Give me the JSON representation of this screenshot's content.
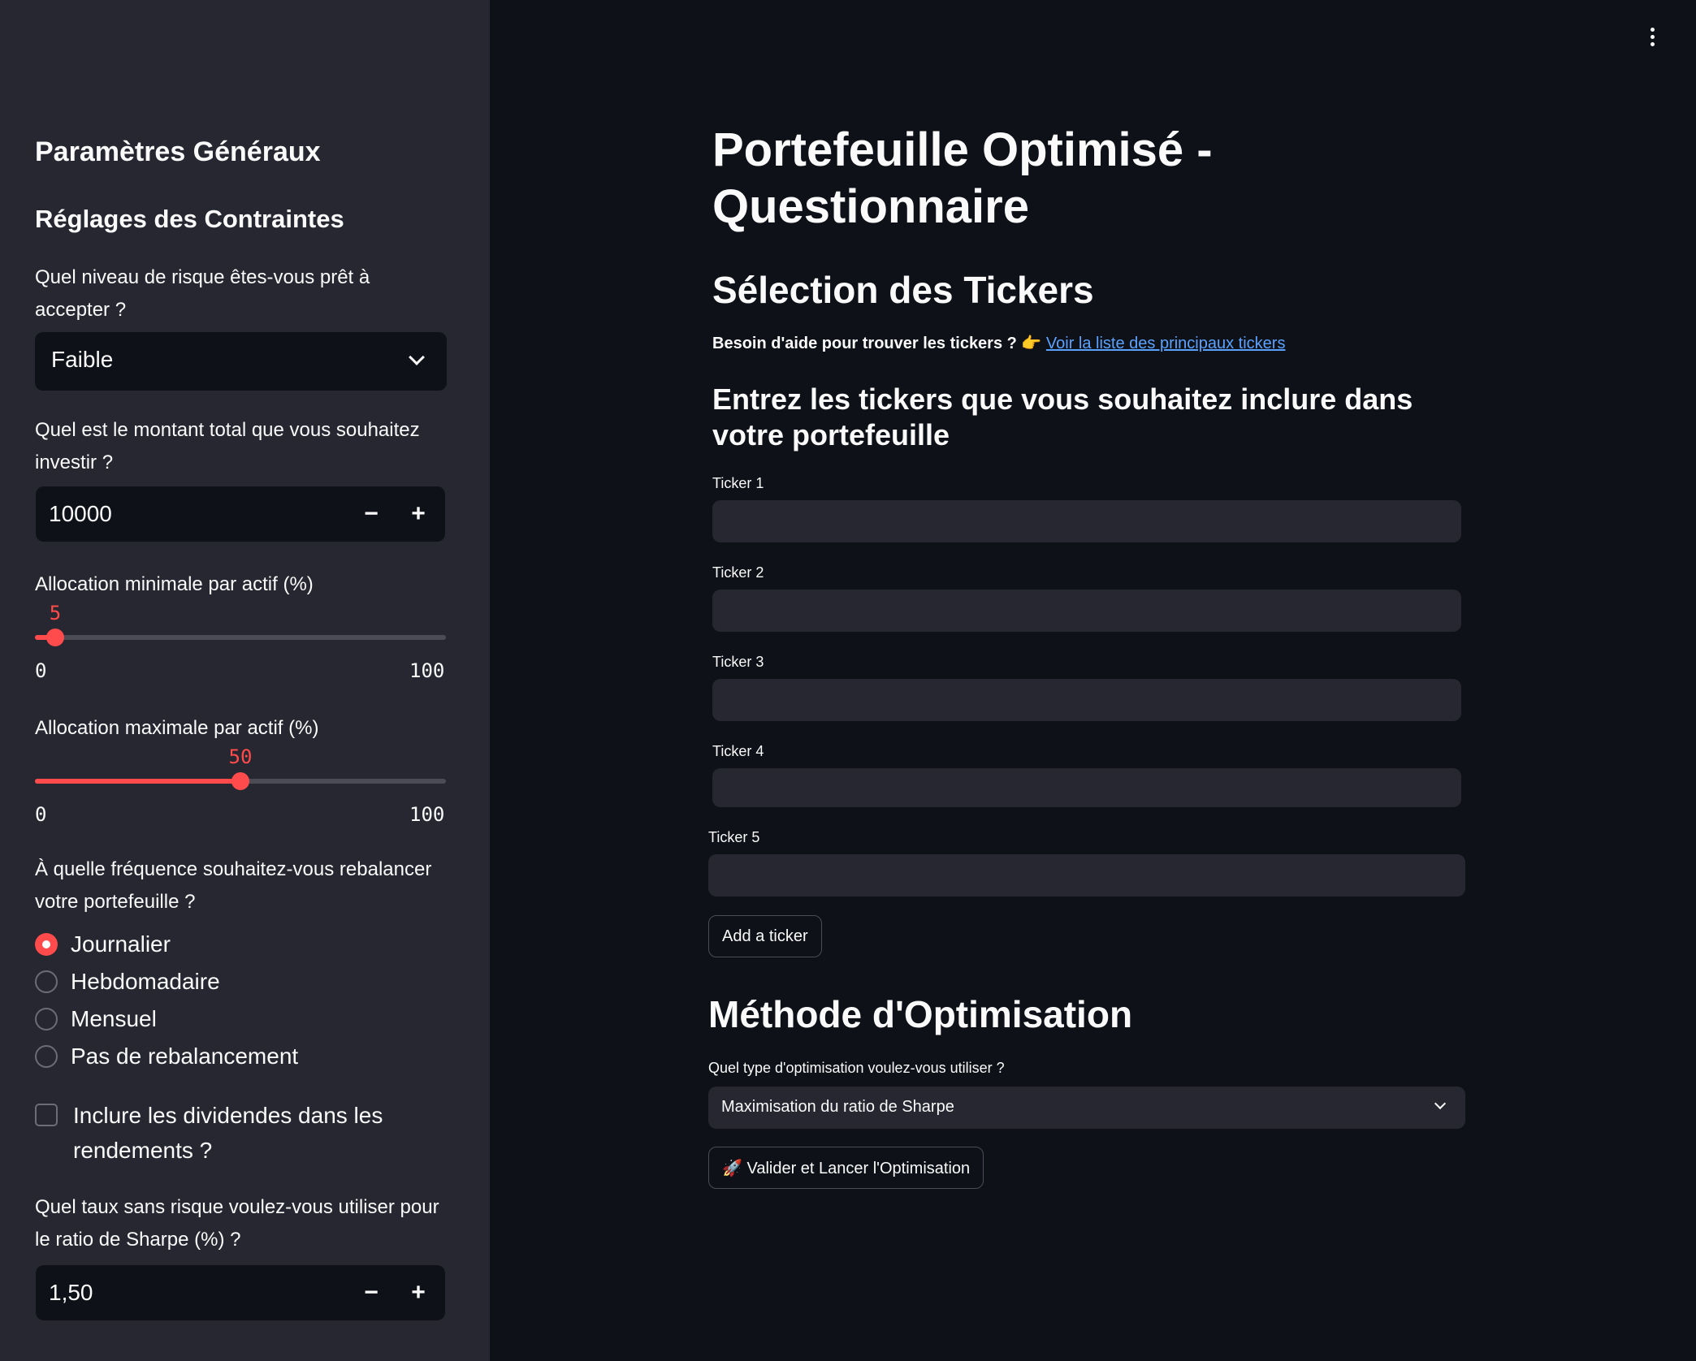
{
  "sidebar": {
    "title": "Paramètres Généraux",
    "subtitle": "Réglages des Contraintes",
    "risk": {
      "label": "Quel niveau de risque êtes-vous prêt à accepter ?",
      "value": "Faible"
    },
    "amount": {
      "label": "Quel est le montant total que vous souhaitez investir ?",
      "value": "10000",
      "minus": "−",
      "plus": "+"
    },
    "min_alloc": {
      "label": "Allocation minimale par actif (%)",
      "value": "5",
      "min": "0",
      "max": "100",
      "fraction": 0.05
    },
    "max_alloc": {
      "label": "Allocation maximale par actif (%)",
      "value": "50",
      "min": "0",
      "max": "100",
      "fraction": 0.5
    },
    "rebalance": {
      "label": "À quelle fréquence souhaitez-vous rebalancer votre portefeuille ?",
      "options": [
        "Journalier",
        "Hebdomadaire",
        "Mensuel",
        "Pas de rebalancement"
      ],
      "selected": "Journalier"
    },
    "dividends": {
      "label": "Inclure les dividendes dans les rendements ?",
      "checked": false
    },
    "riskfree": {
      "label": "Quel taux sans risque voulez-vous utiliser pour le ratio de Sharpe (%) ?",
      "value": "1,50",
      "minus": "−",
      "plus": "+"
    }
  },
  "main": {
    "title": "Portefeuille Optimisé - Questionnaire",
    "tickers_header": "Sélection des Tickers",
    "help_text": "Besoin d'aide pour trouver les tickers ? 👉",
    "help_link": "Voir la liste des principaux tickers",
    "enter_header": "Entrez les tickers que vous souhaitez inclure dans votre portefeuille",
    "tickers": [
      {
        "label": "Ticker 1",
        "value": ""
      },
      {
        "label": "Ticker 2",
        "value": ""
      },
      {
        "label": "Ticker 3",
        "value": ""
      },
      {
        "label": "Ticker 4",
        "value": ""
      },
      {
        "label": "Ticker 5",
        "value": ""
      }
    ],
    "add_button": "Add a ticker",
    "method_header": "Méthode d'Optimisation",
    "method_label": "Quel type d'optimisation voulez-vous utiliser ?",
    "method_value": "Maximisation du ratio de Sharpe",
    "launch_button": "🚀 Valider et Lancer l'Optimisation"
  },
  "colors": {
    "accent": "#ff4b4b",
    "sidebar_bg": "#262730",
    "main_bg": "#0e1117",
    "link": "#5ba2ff"
  }
}
